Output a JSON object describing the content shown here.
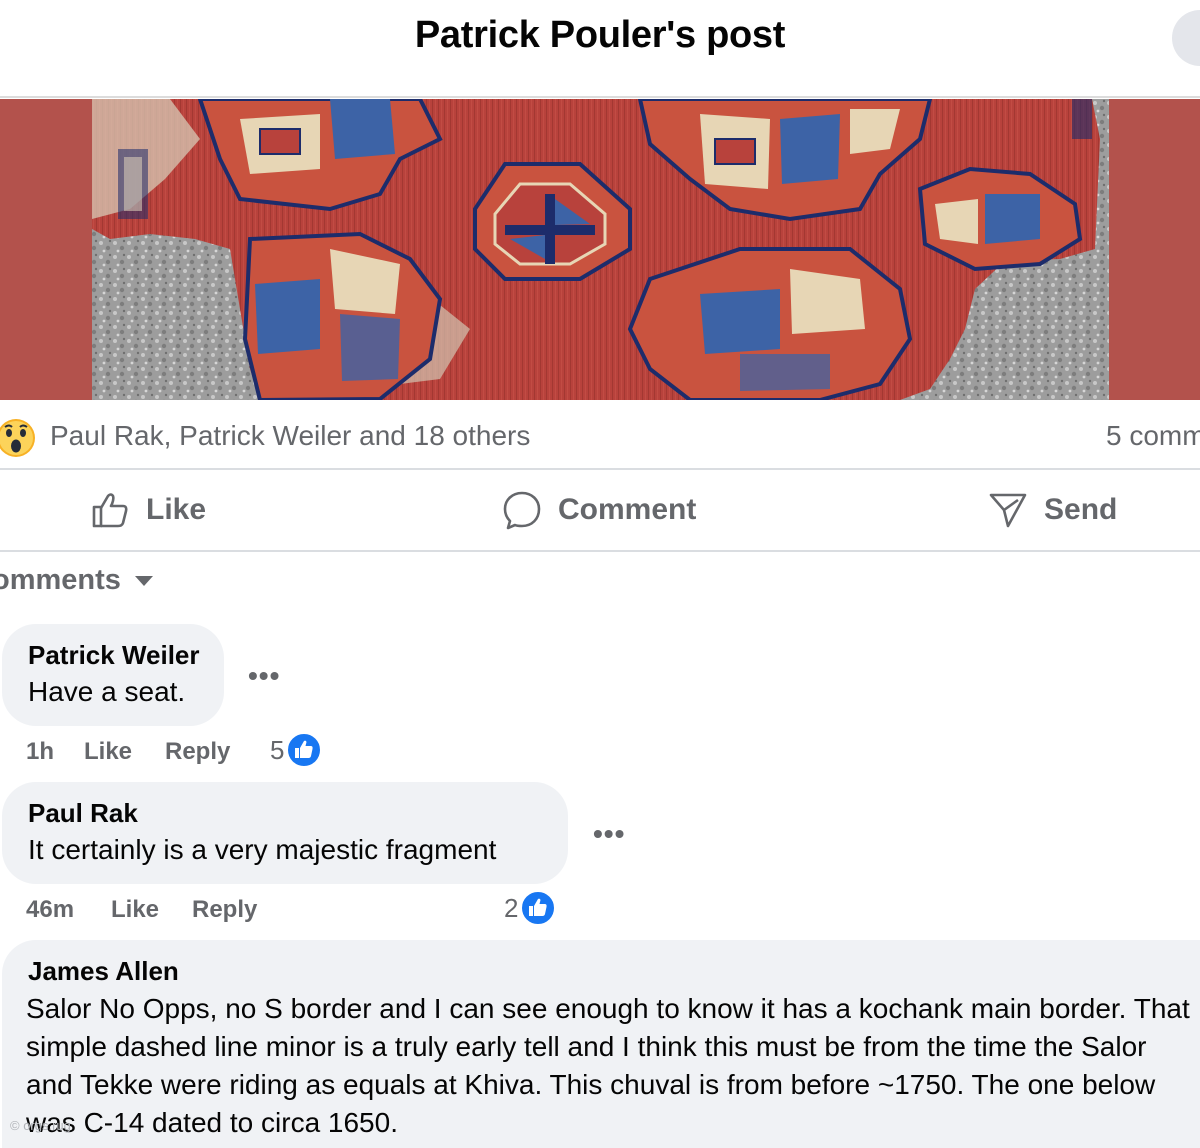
{
  "header": {
    "title": "Patrick Pouler's post"
  },
  "post": {
    "image_alt": "Antique Salor chuval rug fragment with gul medallions on red field",
    "reactions": {
      "icon": "wow-emoji-icon",
      "reactors": "Paul Rak, Patrick Weiler and 18 others",
      "comment_count": "5 comm"
    },
    "actions": {
      "like": "Like",
      "comment": "Comment",
      "send": "Send"
    }
  },
  "comments_section": {
    "sort_label": "omments"
  },
  "comments": [
    {
      "author": "Patrick Weiler",
      "text": "Have a seat.",
      "time": "1h",
      "like_label": "Like",
      "reply_label": "Reply",
      "like_count": "5"
    },
    {
      "author": "Paul Rak",
      "text": "It certainly is a very majestic fragment",
      "time": "46m",
      "like_label": "Like",
      "reply_label": "Reply",
      "like_count": "2"
    },
    {
      "author": "James Allen",
      "text": "Salor No Opps, no S border and I can see enough to know it has a kochank main border. That simple dashed line minor is a truly early tell and I think this must be from the time the Salor and Tekke were riding as equals at Khiva. This chuval is from before ~1750. The one below was C-14 dated to circa 1650."
    }
  ],
  "colors": {
    "accent_blue": "#1877f2",
    "muted_text": "#65676b",
    "bubble_bg": "#f0f2f5",
    "rug_red": "#b8423c"
  },
  "watermark": "© orgs.rug"
}
